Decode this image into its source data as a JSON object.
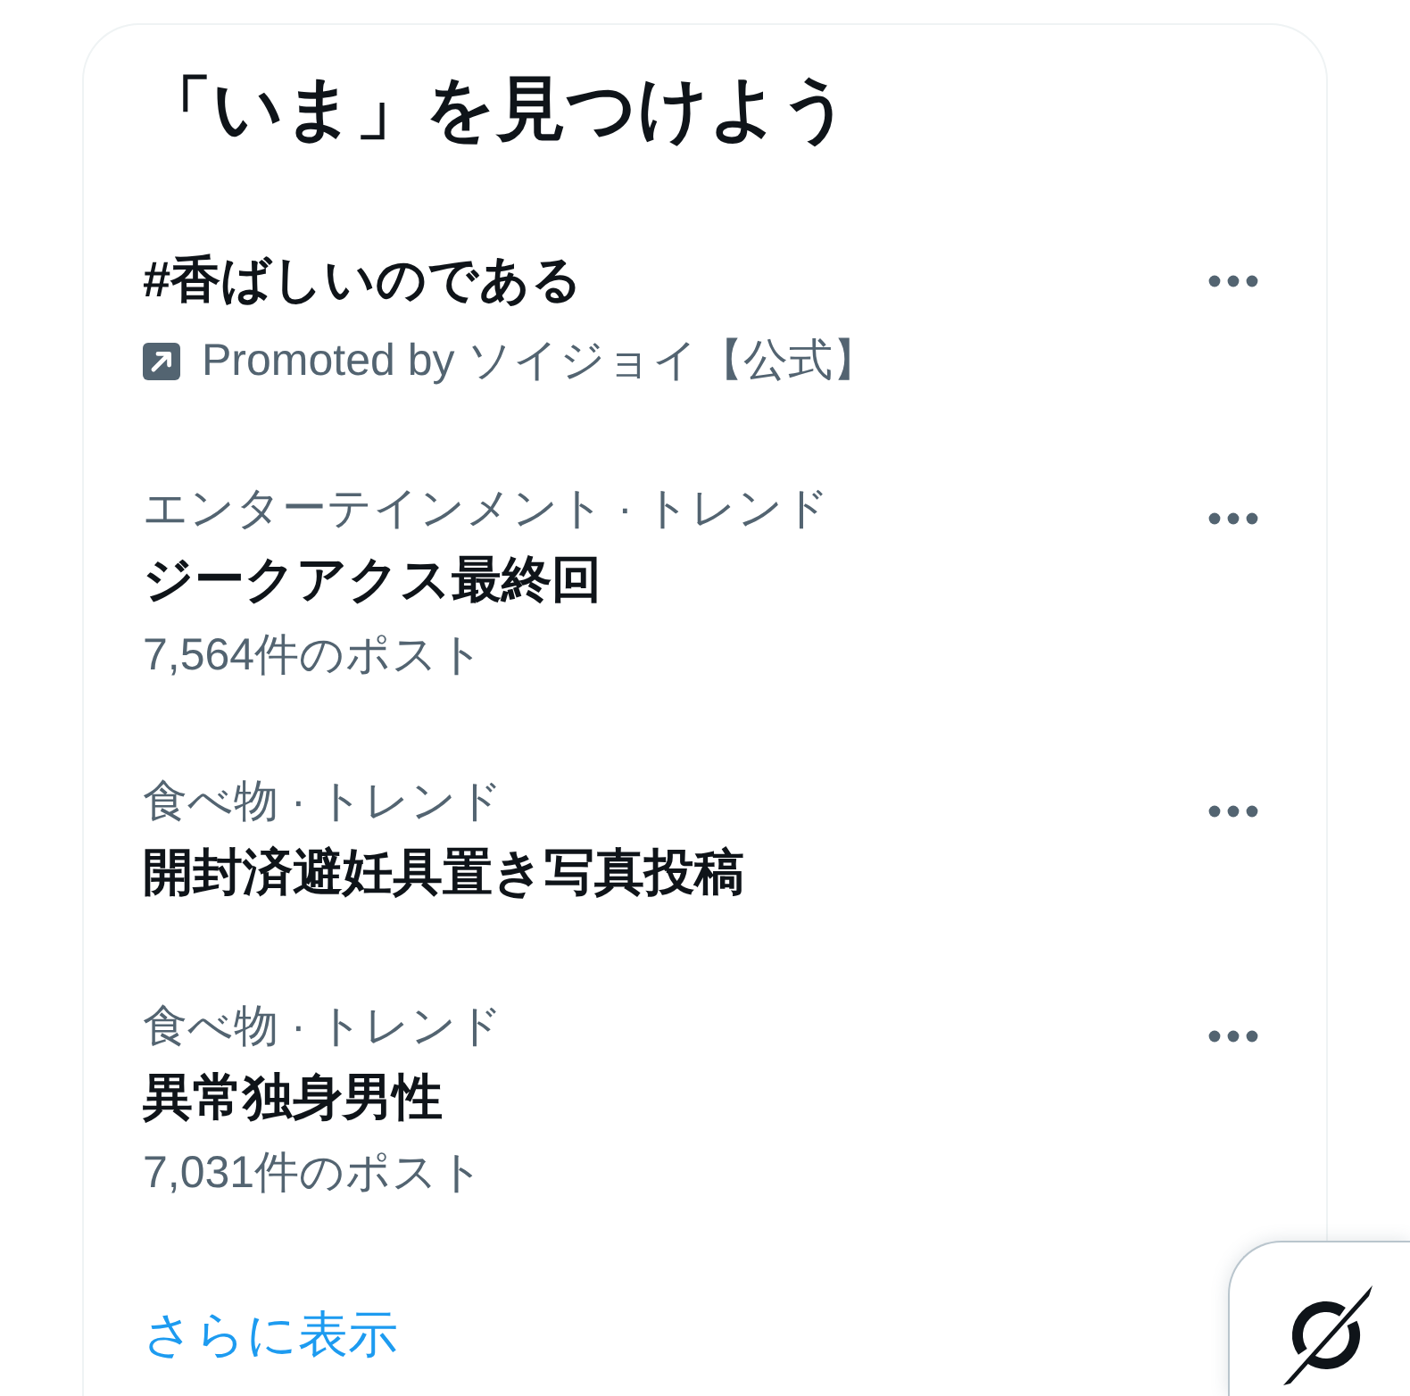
{
  "section": {
    "title": "「いま」を見つけよう"
  },
  "trends": [
    {
      "kind": "promoted",
      "name": "#香ばしいのである",
      "promoted_by": "Promoted by ソイジョイ【公式】"
    },
    {
      "kind": "trend",
      "category": "エンターテインメント · トレンド",
      "name": "ジークアクス最終回",
      "post_count": "7,564件のポスト"
    },
    {
      "kind": "trend",
      "category": "食べ物 · トレンド",
      "name": "開封済避妊具置き写真投稿"
    },
    {
      "kind": "trend",
      "category": "食べ物 · トレンド",
      "name": "異常独身男性",
      "post_count": "7,031件のポスト"
    }
  ],
  "show_more": "さらに表示"
}
